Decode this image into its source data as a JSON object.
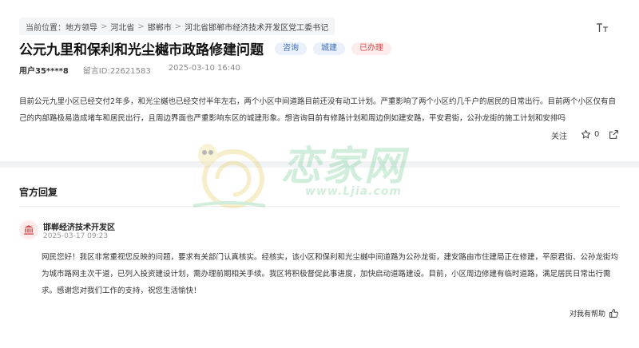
{
  "breadcrumb": {
    "prefix": "当前位置：",
    "items": [
      "地方领导",
      "河北省",
      "邯郸市",
      "河北省邯郸市经济技术开发区党工委书记"
    ]
  },
  "font_toggle_icon": "font-size-icon",
  "post": {
    "title": "公元九里和保利和光尘樾市政路修建问题",
    "tags": [
      {
        "label": "咨询",
        "color": "#3d6fb6"
      },
      {
        "label": "城建",
        "color": "#3d6fb6"
      },
      {
        "label": "已办理",
        "color": "#d64a4a"
      }
    ],
    "user": "用户35****8",
    "message_id": "留言ID:22621583",
    "datetime": "2025-03-10 16:40",
    "content": "目前公元九里小区已经交付2年多，和光尘樾也已经交付半年左右，两个小区中间道路目前还没有动工计划。严重影响了两个小区约几千户的居民的日常出行。目前两个小区仅有自己的内部路极易造成堵车和居民出行，且周边界面也严重影响东区的城建形象。想咨询目前有修路计划和周边例如建安路，平安君街，公孙龙街的施工计划和安排吗",
    "follow_label": "关注",
    "star_count": "0"
  },
  "reply": {
    "section_title": "官方回复",
    "org_name": "邯郸经济技术开发区",
    "date": "2025-03-17 09:23",
    "content": "网民您好！我区非常重视您反映的问题，要求有关部门认真核实。经核实，该小区和保利和光尘樾中间道路为公孙龙街，建安路由市住建局正在修建，平原君街、公孙龙街均为城市路网主次干道，已列入投资建设计划，需办理前期相关手续。我区将积极督促此事进度，加快启动道路建设。目前，小区周边修建有临时道路，满足居民日常出行需求。感谢您对我们工作的支持，祝您生活愉快！",
    "helpful_label": "对我有帮助"
  },
  "watermark": {
    "text": "恋家网",
    "url": "www.Ljia.com"
  },
  "colors": {
    "tag_blue_bg": "#eaf1fb",
    "tag_red_bg": "#fdecec",
    "watermark": "#7bcf9a"
  }
}
